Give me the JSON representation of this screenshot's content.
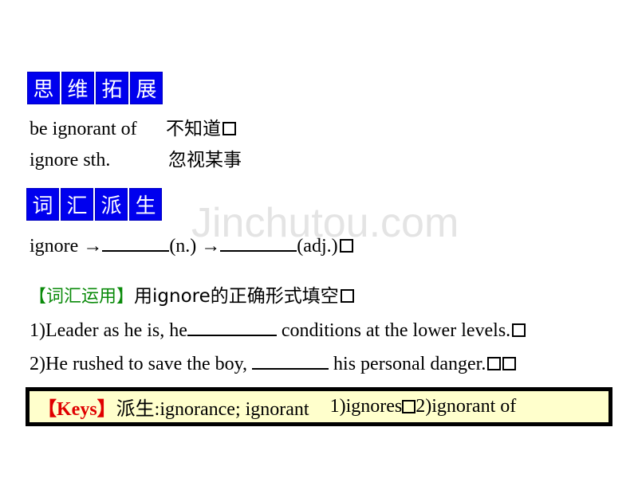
{
  "section1": {
    "tag_chars": [
      "思",
      "维",
      "拓",
      "展"
    ],
    "phrases": [
      {
        "en": "be ignorant of",
        "zh": "不知道"
      },
      {
        "en": "ignore sth.",
        "zh": "忽视某事"
      }
    ]
  },
  "section2": {
    "tag_chars": [
      "词",
      "汇",
      "派",
      "生"
    ],
    "derivation": {
      "word": "ignore",
      "arrow": "→",
      "noun_label": "(n.)",
      "adj_label": "(adj.)"
    }
  },
  "watermark": "Jinchutou.com",
  "exercise": {
    "heading_bracket": "【词汇运用】",
    "instruction": "用ignore的正确形式填空",
    "items": [
      {
        "prefix": "1)Leader as he is, he",
        "suffix": " conditions at the lower levels."
      },
      {
        "prefix": "2)He rushed to save the boy, ",
        "suffix": " his personal danger."
      }
    ]
  },
  "keys": {
    "label": "【Keys】",
    "derivation_text": "派生:ignorance; ignorant",
    "answer1": "1)ignores",
    "answer2": "2)ignorant of"
  },
  "colors": {
    "tag_bg": "#0000ee",
    "heading_green": "#0a8a0a",
    "keys_red": "#e00000",
    "keys_bg": "#ffffcc"
  }
}
